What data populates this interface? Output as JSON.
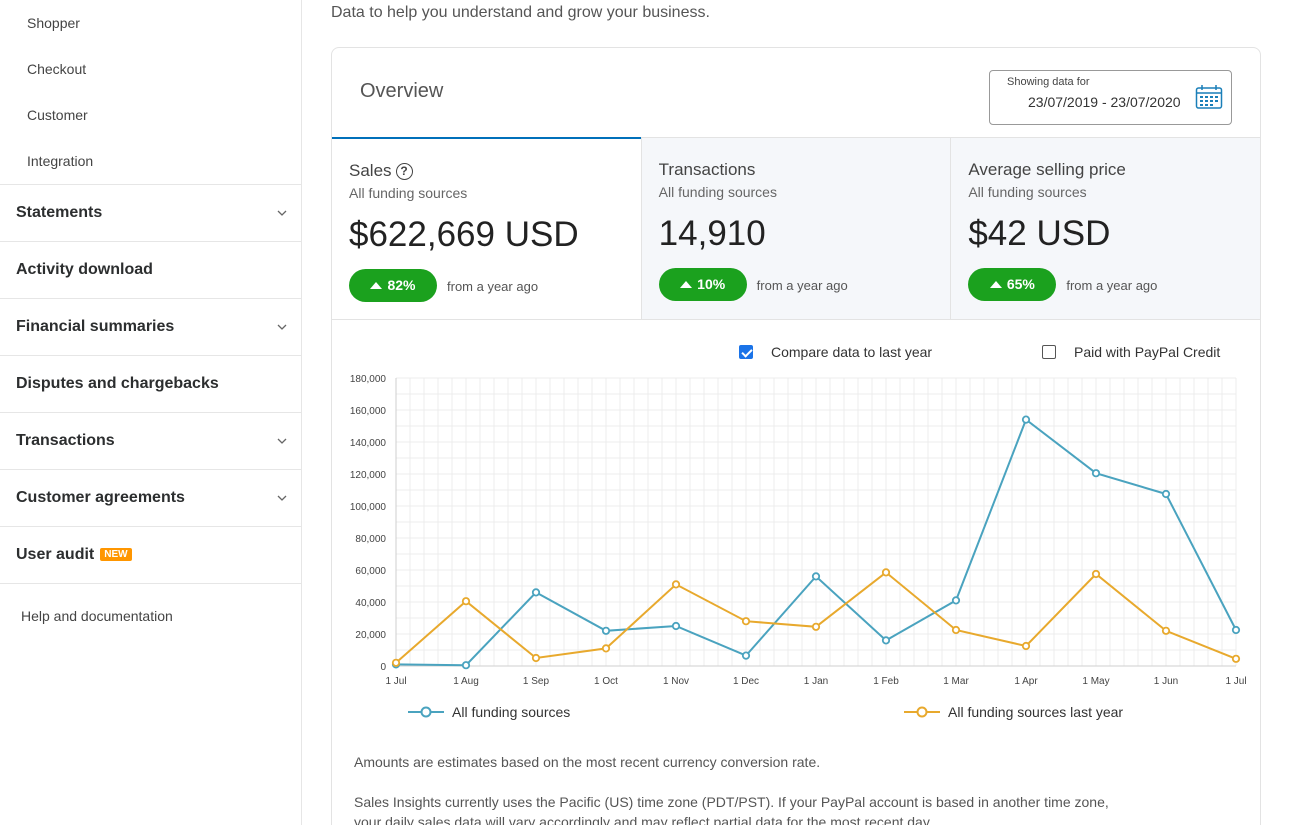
{
  "sidebar": {
    "sub_items": [
      "Shopper",
      "Checkout",
      "Customer",
      "Integration"
    ],
    "main_items": [
      {
        "label": "Statements",
        "chevron": true
      },
      {
        "label": "Activity download",
        "chevron": false
      },
      {
        "label": "Financial summaries",
        "chevron": true
      },
      {
        "label": "Disputes and chargebacks",
        "chevron": false
      },
      {
        "label": "Transactions",
        "chevron": true
      },
      {
        "label": "Customer agreements",
        "chevron": true
      },
      {
        "label": "User audit",
        "chevron": false,
        "badge": "NEW"
      }
    ],
    "help": "Help and documentation"
  },
  "main": {
    "subtitle": "Data to help you understand and grow your business.",
    "overview_title": "Overview",
    "date_label": "Showing data for",
    "date_value": "23/07/2019 - 23/07/2020",
    "metrics": [
      {
        "title": "Sales",
        "sub": "All funding sources",
        "value": "$622,669 USD",
        "change": "82%",
        "from": "from a year ago",
        "help": "?"
      },
      {
        "title": "Transactions",
        "sub": "All funding sources",
        "value": "14,910",
        "change": "10%",
        "from": "from a year ago"
      },
      {
        "title": "Average selling price",
        "sub": "All funding sources",
        "value": "$42 USD",
        "change": "65%",
        "from": "from a year ago"
      }
    ],
    "compare_label": "Compare data to last year",
    "compare_checked": true,
    "credit_label": "Paid with PayPal Credit",
    "credit_checked": false,
    "note1": "Amounts are estimates based on the most recent currency conversion rate.",
    "note2a": "Sales Insights currently uses the Pacific (US) time zone (PDT/PST). If your PayPal account is based in another time zone,",
    "note2b": "your daily sales data will vary accordingly and may reflect partial data for the most recent day."
  },
  "chart_data": {
    "type": "line",
    "x": [
      "1 Jul",
      "1 Aug",
      "1 Sep",
      "1 Oct",
      "1 Nov",
      "1 Dec",
      "1 Jan",
      "1 Feb",
      "1 Mar",
      "1 Apr",
      "1 May",
      "1 Jun",
      "1 Jul"
    ],
    "y_ticks": [
      "0",
      "20,000",
      "40,000",
      "60,000",
      "80,000",
      "100,000",
      "120,000",
      "140,000",
      "160,000",
      "180,000"
    ],
    "ylim": [
      0,
      180000
    ],
    "grid": true,
    "legend": "bottom",
    "series": [
      {
        "name": "All funding sources",
        "color": "#4aa3bf",
        "values": [
          1000,
          500,
          46000,
          22000,
          25000,
          6500,
          56000,
          16000,
          41000,
          154000,
          120500,
          107500,
          22500
        ]
      },
      {
        "name": "All funding sources last year",
        "color": "#e8a92d",
        "values": [
          2000,
          40500,
          5000,
          11000,
          51000,
          28000,
          24500,
          58500,
          22500,
          12500,
          57500,
          22000,
          4500
        ]
      }
    ]
  },
  "colors": {
    "accent": "#0070ba",
    "positive": "#1ba11e",
    "badge": "#ff9600"
  }
}
